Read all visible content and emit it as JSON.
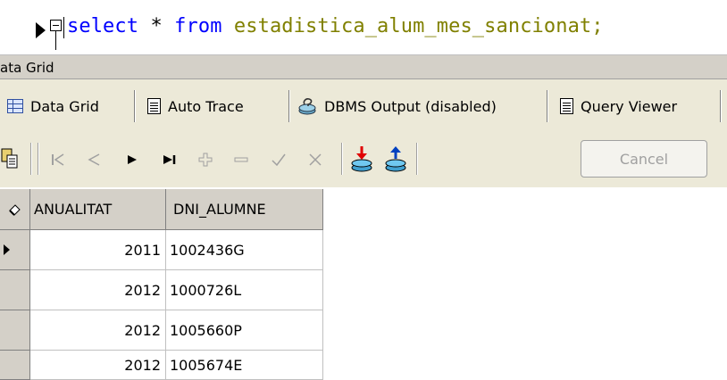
{
  "editor": {
    "sql_keyword_select": "select",
    "sql_star": "*",
    "sql_keyword_from": "from",
    "sql_table": "estadistica_alum_mes_sancionat;"
  },
  "caption": "ata Grid",
  "tabs": [
    {
      "label": "Data Grid",
      "icon": "grid-icon"
    },
    {
      "label": "Auto Trace",
      "icon": "document-icon"
    },
    {
      "label": "DBMS Output (disabled)",
      "icon": "dbms-output-icon"
    },
    {
      "label": "Query Viewer",
      "icon": "document-icon"
    }
  ],
  "toolbar": {
    "cancel_label": "Cancel",
    "icons": [
      "copy-icon",
      "first-record-icon",
      "prior-record-icon",
      "next-record-icon",
      "last-record-icon",
      "insert-record-icon",
      "delete-record-icon",
      "post-edit-icon",
      "cancel-edit-icon",
      "import-icon",
      "export-icon"
    ]
  },
  "grid": {
    "columns": [
      "ANUALITAT",
      "DNI_ALUMNE"
    ],
    "rows": [
      {
        "anualitat": "2011",
        "dni": "1002436G"
      },
      {
        "anualitat": "2012",
        "dni": "1000726L"
      },
      {
        "anualitat": "2012",
        "dni": "1005660P"
      },
      {
        "anualitat": "2012",
        "dni": "1005674E"
      }
    ]
  },
  "colors": {
    "keyword": "#0000ff",
    "identifier": "#808000",
    "panel": "#ece9d8",
    "header": "#d4d0c8"
  }
}
